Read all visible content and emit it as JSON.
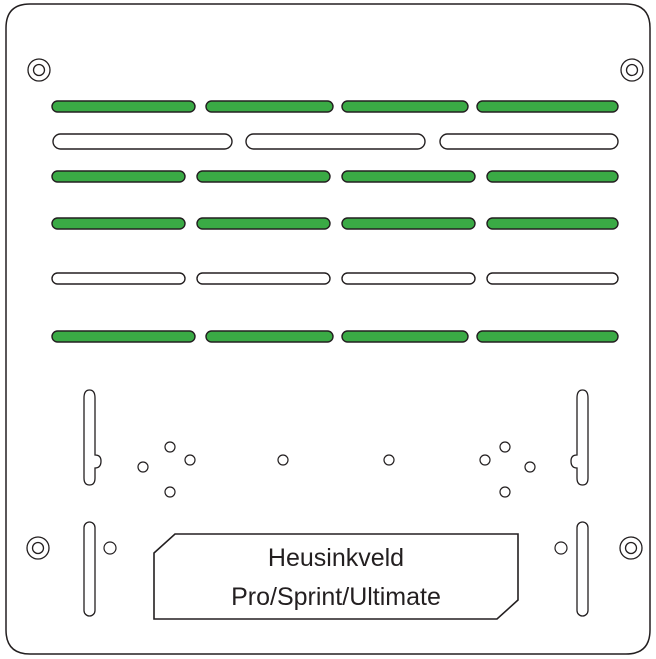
{
  "plate": {
    "label_line1": "Heusinkveld",
    "label_line2": "Pro/Sprint/Ultimate"
  },
  "colors": {
    "stroke": "#231f20",
    "slot_fill_highlight": "#3aaa45",
    "slot_fill_plain": "#ffffff",
    "plate_fill": "#ffffff"
  },
  "legend_semantics": {
    "highlighted_slots": "green-filled slot rows",
    "plain_slots": "outlined slot rows"
  }
}
